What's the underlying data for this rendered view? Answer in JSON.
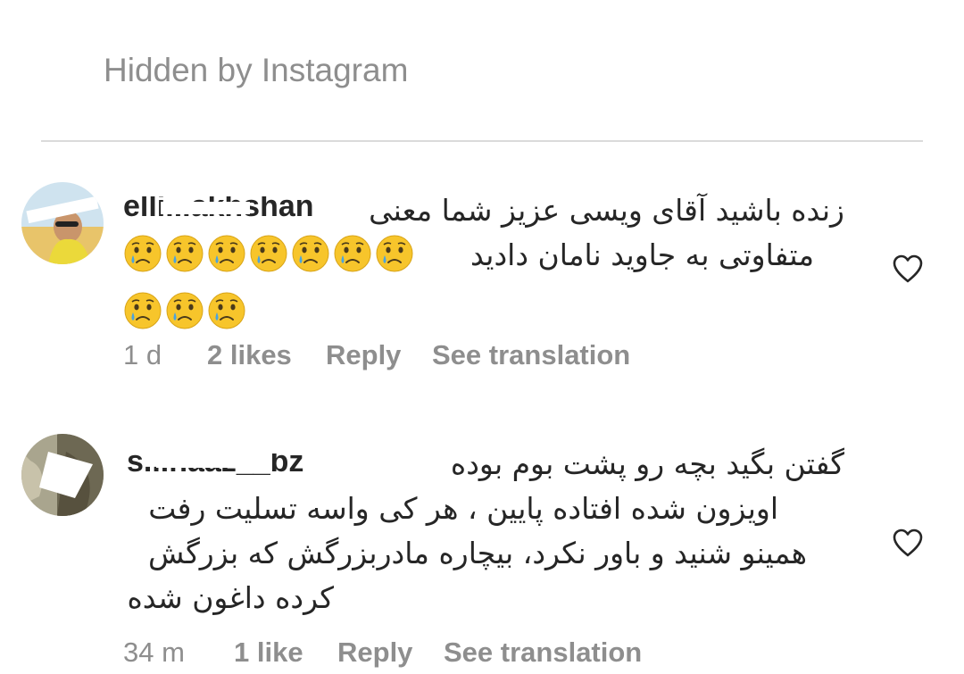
{
  "header": {
    "hidden_label": "Hidden by Instagram"
  },
  "comments": [
    {
      "username": "elli...akhshan",
      "text_lines": [
        "زنده باشید آقای ویسی عزیز شما معنی",
        "متفاوتی به جاوید نامان دادید"
      ],
      "emoji_count": 10,
      "emoji_name": "crying-face",
      "time": "1 d",
      "likes": "2 likes",
      "reply": "Reply",
      "translate": "See translation"
    },
    {
      "username": "s...naaz__bz",
      "text_lines": [
        "گفتن بگید بچه رو پشت بوم بوده",
        "اویزون شده افتاده پایین ، هر کی واسه تسلیت رفت",
        "همینو شنید و باور نکرد، بیچاره مادربزرگش که بزرگش",
        "کرده داغون شده"
      ],
      "time": "34 m",
      "likes": "1 like",
      "reply": "Reply",
      "translate": "See translation"
    }
  ],
  "icons": {
    "like": "heart-outline-icon",
    "back": "chevron-left-icon",
    "emoji": "crying-face-emoji"
  },
  "colors": {
    "text": "#262626",
    "secondary": "#8e8e8e",
    "divider": "#dbdbdb",
    "emoji_face": "#f7c52b",
    "tear": "#4aa3df"
  }
}
